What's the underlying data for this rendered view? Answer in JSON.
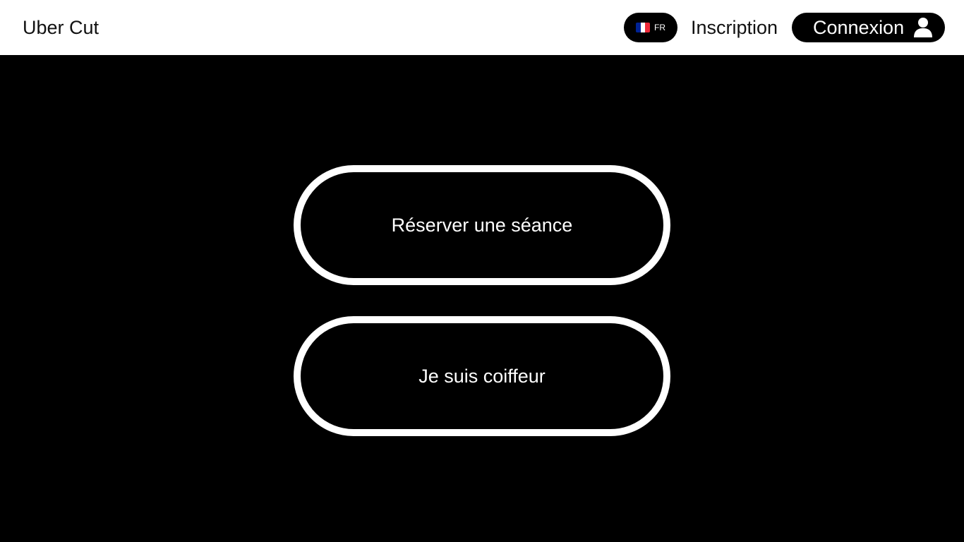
{
  "header": {
    "brand": "Uber Cut",
    "language": {
      "code": "FR",
      "flag_icon": "france-flag-icon",
      "flag_colors": [
        "#002395",
        "#ffffff",
        "#ed2939"
      ]
    },
    "signup_label": "Inscription",
    "login_label": "Connexion",
    "login_icon": "user-icon"
  },
  "main": {
    "book_button_label": "Réserver une séance",
    "barber_button_label": "Je suis coiffeur"
  },
  "colors": {
    "header_background": "#ffffff",
    "main_background": "#000000",
    "accent": "#000000",
    "text_on_dark": "#ffffff"
  }
}
